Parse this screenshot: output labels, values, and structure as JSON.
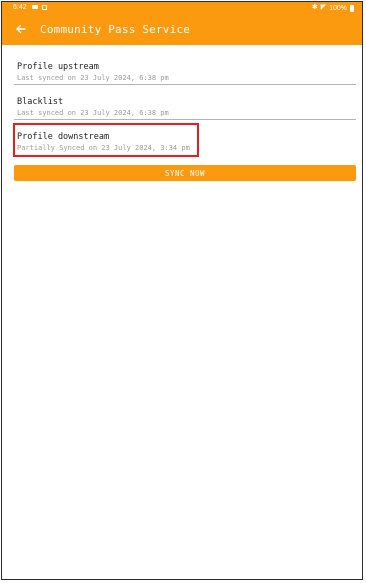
{
  "status_bar": {
    "time": "6:42",
    "battery": "100%"
  },
  "app_bar": {
    "title": "Community Pass Service",
    "back_icon": "arrow-left-icon"
  },
  "sync_items": [
    {
      "title": "Profile upstream",
      "subtitle": "Last synced on 23 July 2024, 6:38 pm"
    },
    {
      "title": "Blacklist",
      "subtitle": "Last synced on 23 July 2024, 6:38 pm"
    },
    {
      "title": "Profile downstream",
      "subtitle": "Partially Synced on 23 July 2024, 3:34 pm"
    }
  ],
  "sync_button": {
    "label": "SYNC NOW"
  },
  "colors": {
    "accent": "#fb9a0e",
    "highlight": "#e02020",
    "subtitle": "#9a9a9a"
  }
}
